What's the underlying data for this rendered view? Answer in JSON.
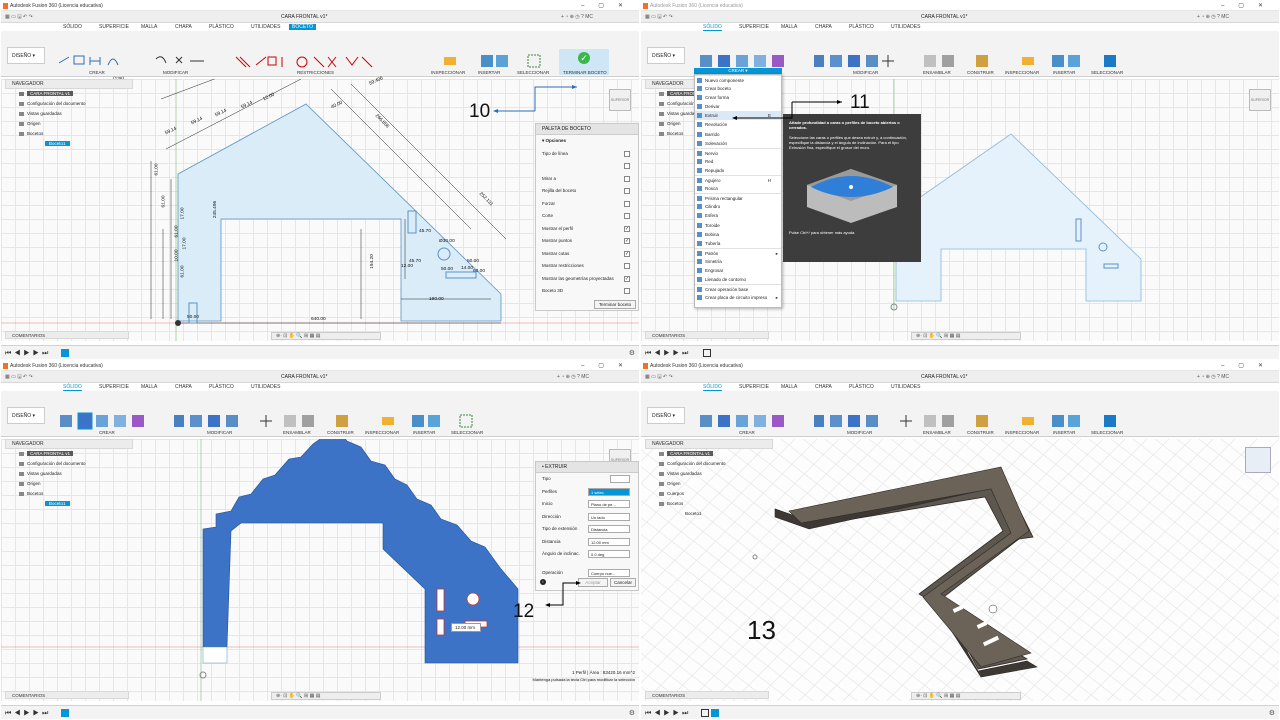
{
  "app_title": "Autodesk Fusion 360 (Licencia educativa)",
  "doc_title_q1": "CARA FRONTAL v1*",
  "doc_title_q3": "CARA FRONTAL v1*",
  "workspace": "DISEÑO",
  "tabs": {
    "solido": "SÓLIDO",
    "superficie": "SUPERFICIE",
    "malla": "MALLA",
    "chapa": "CHAPA",
    "plastico": "PLÁSTICO",
    "utilidades": "UTILIDADES",
    "boceto": "BOCETO"
  },
  "ribbon_q1": {
    "crear": "CREAR",
    "modificar": "MODIFICAR",
    "restricciones": "RESTRICCIONES",
    "inspeccionar": "INSPECCIONAR",
    "insertar": "INSERTAR",
    "seleccionar": "SELECCIONAR",
    "terminar": "TERMINAR BOCETO"
  },
  "ribbon_solid": {
    "crear": "CREAR",
    "modificar": "MODIFICAR",
    "ensamblar": "ENSAMBLAR",
    "construir": "CONSTRUIR",
    "inspeccionar": "INSPECCIONAR",
    "insertar": "INSERTAR",
    "seleccionar": "SELECCIONAR"
  },
  "navigator": {
    "header": "NAVEGADOR",
    "root": "CARA FRONTAL v1",
    "items": [
      "Configuración del documento",
      "Vistas guardadas",
      "Origen",
      "Bocetos"
    ],
    "sketch": "Boceto1",
    "q4_items": [
      "Configuración del documento",
      "Vistas guardadas",
      "Origen",
      "Cuerpos",
      "Bocetos"
    ]
  },
  "comments_label": "COMENTARIOS",
  "viewcube_label": "SUPERIOR",
  "sketch_palette": {
    "title": "PALETA DE BOCETO",
    "section": "Opciones",
    "rows": [
      {
        "label": "Tipo de línea",
        "checked": ""
      },
      {
        "label": "",
        "checked": ""
      },
      {
        "label": "Mirar a",
        "checked": ""
      },
      {
        "label": "Rejilla del boceto",
        "checked": ""
      },
      {
        "label": "Forzar",
        "checked": ""
      },
      {
        "label": "Corte",
        "checked": ""
      },
      {
        "label": "Mostrar el perfil",
        "checked": "✓"
      },
      {
        "label": "Mostrar puntos",
        "checked": "✓"
      },
      {
        "label": "Mostrar cotas",
        "checked": "✓"
      },
      {
        "label": "Mostrar restricciones",
        "checked": ""
      },
      {
        "label": "Mostrar las geometrías proyectadas",
        "checked": "✓"
      },
      {
        "label": "Boceto 3D",
        "checked": ""
      }
    ],
    "finish_button": "Terminar boceto"
  },
  "dimensions": [
    "(136)",
    "59.14",
    "59.14",
    "59.14",
    "59.14",
    "12.00",
    "40.00",
    "266.856",
    "59.406",
    "252.131",
    "245.496",
    "61.00",
    "61.00",
    "17.00",
    "61.00",
    "17.00",
    "10.00",
    "61.00",
    "194.20",
    "45.70",
    "45.70",
    "50.00",
    "Ø30.00",
    "50.00",
    "60.00",
    "190.00",
    "50.00",
    "640.00",
    "12.00",
    "14.00"
  ],
  "create_menu": {
    "header": "CREAR",
    "items": [
      "Nuevo componente",
      "Crear boceto",
      "Crear forma",
      "Derivar",
      "Extruir",
      "Revolución",
      "Barrido",
      "Solevación",
      "Nervio",
      "Red",
      "Repujado",
      "Agujero",
      "Rosca",
      "Prisma rectangular",
      "Cilindro",
      "Esfera",
      "Toroide",
      "Bobina",
      "Tubería",
      "Patrón",
      "Simetría",
      "Engrosar",
      "Llenado de contorno",
      "Crear operación base",
      "Crear placa de circuito impreso"
    ],
    "highlighted": "Extruir",
    "shortcut_extrude": "E",
    "shortcut_hole": "H"
  },
  "tooltip": {
    "title": "Añade profundidad a caras o perfiles de boceto abiertos o cerrados.",
    "body": "Seleccione las caras o perfiles que desea extruir y, a continuación, especifique la distancia y el ángulo de inclinación. Para el tipo Extrusión fina, especifique el grosor del muro.",
    "help": "Pulse Ctrl+/ para obtener más ayuda."
  },
  "extrude_panel": {
    "title": "EXTRUIR",
    "rows": [
      {
        "label": "Tipo",
        "value": ""
      },
      {
        "label": "Perfiles",
        "value": "1 selec."
      },
      {
        "label": "Inicio",
        "value": "Plano de pe..."
      },
      {
        "label": "Dirección",
        "value": "Un lado"
      },
      {
        "label": "Tipo de extensión",
        "value": "Distancia"
      },
      {
        "label": "Distancia",
        "value": "12.00 mm"
      },
      {
        "label": "Ángulo de inclinac.",
        "value": "0.0 deg"
      },
      {
        "label": "Operación",
        "value": "Cuerpo nue..."
      }
    ],
    "accept": "Aceptar",
    "cancel": "Cancelar",
    "canvas_value": "12.00 mm"
  },
  "status_q3": "1 Perfil | Área : 83420.16 mm^2",
  "status_q3_hint": "Mantenga pulsada la tecla Ctrl para modificar la selección",
  "step_numbers": {
    "s10": "10",
    "s11": "11",
    "s12": "12",
    "s13": "13"
  },
  "colors": {
    "accent": "#0696d7",
    "sketch_fill": "#d9ecf8",
    "profile_blue": "#3c73c7",
    "body_gray": "#6b6258",
    "finish_green": "#3ab74a"
  }
}
